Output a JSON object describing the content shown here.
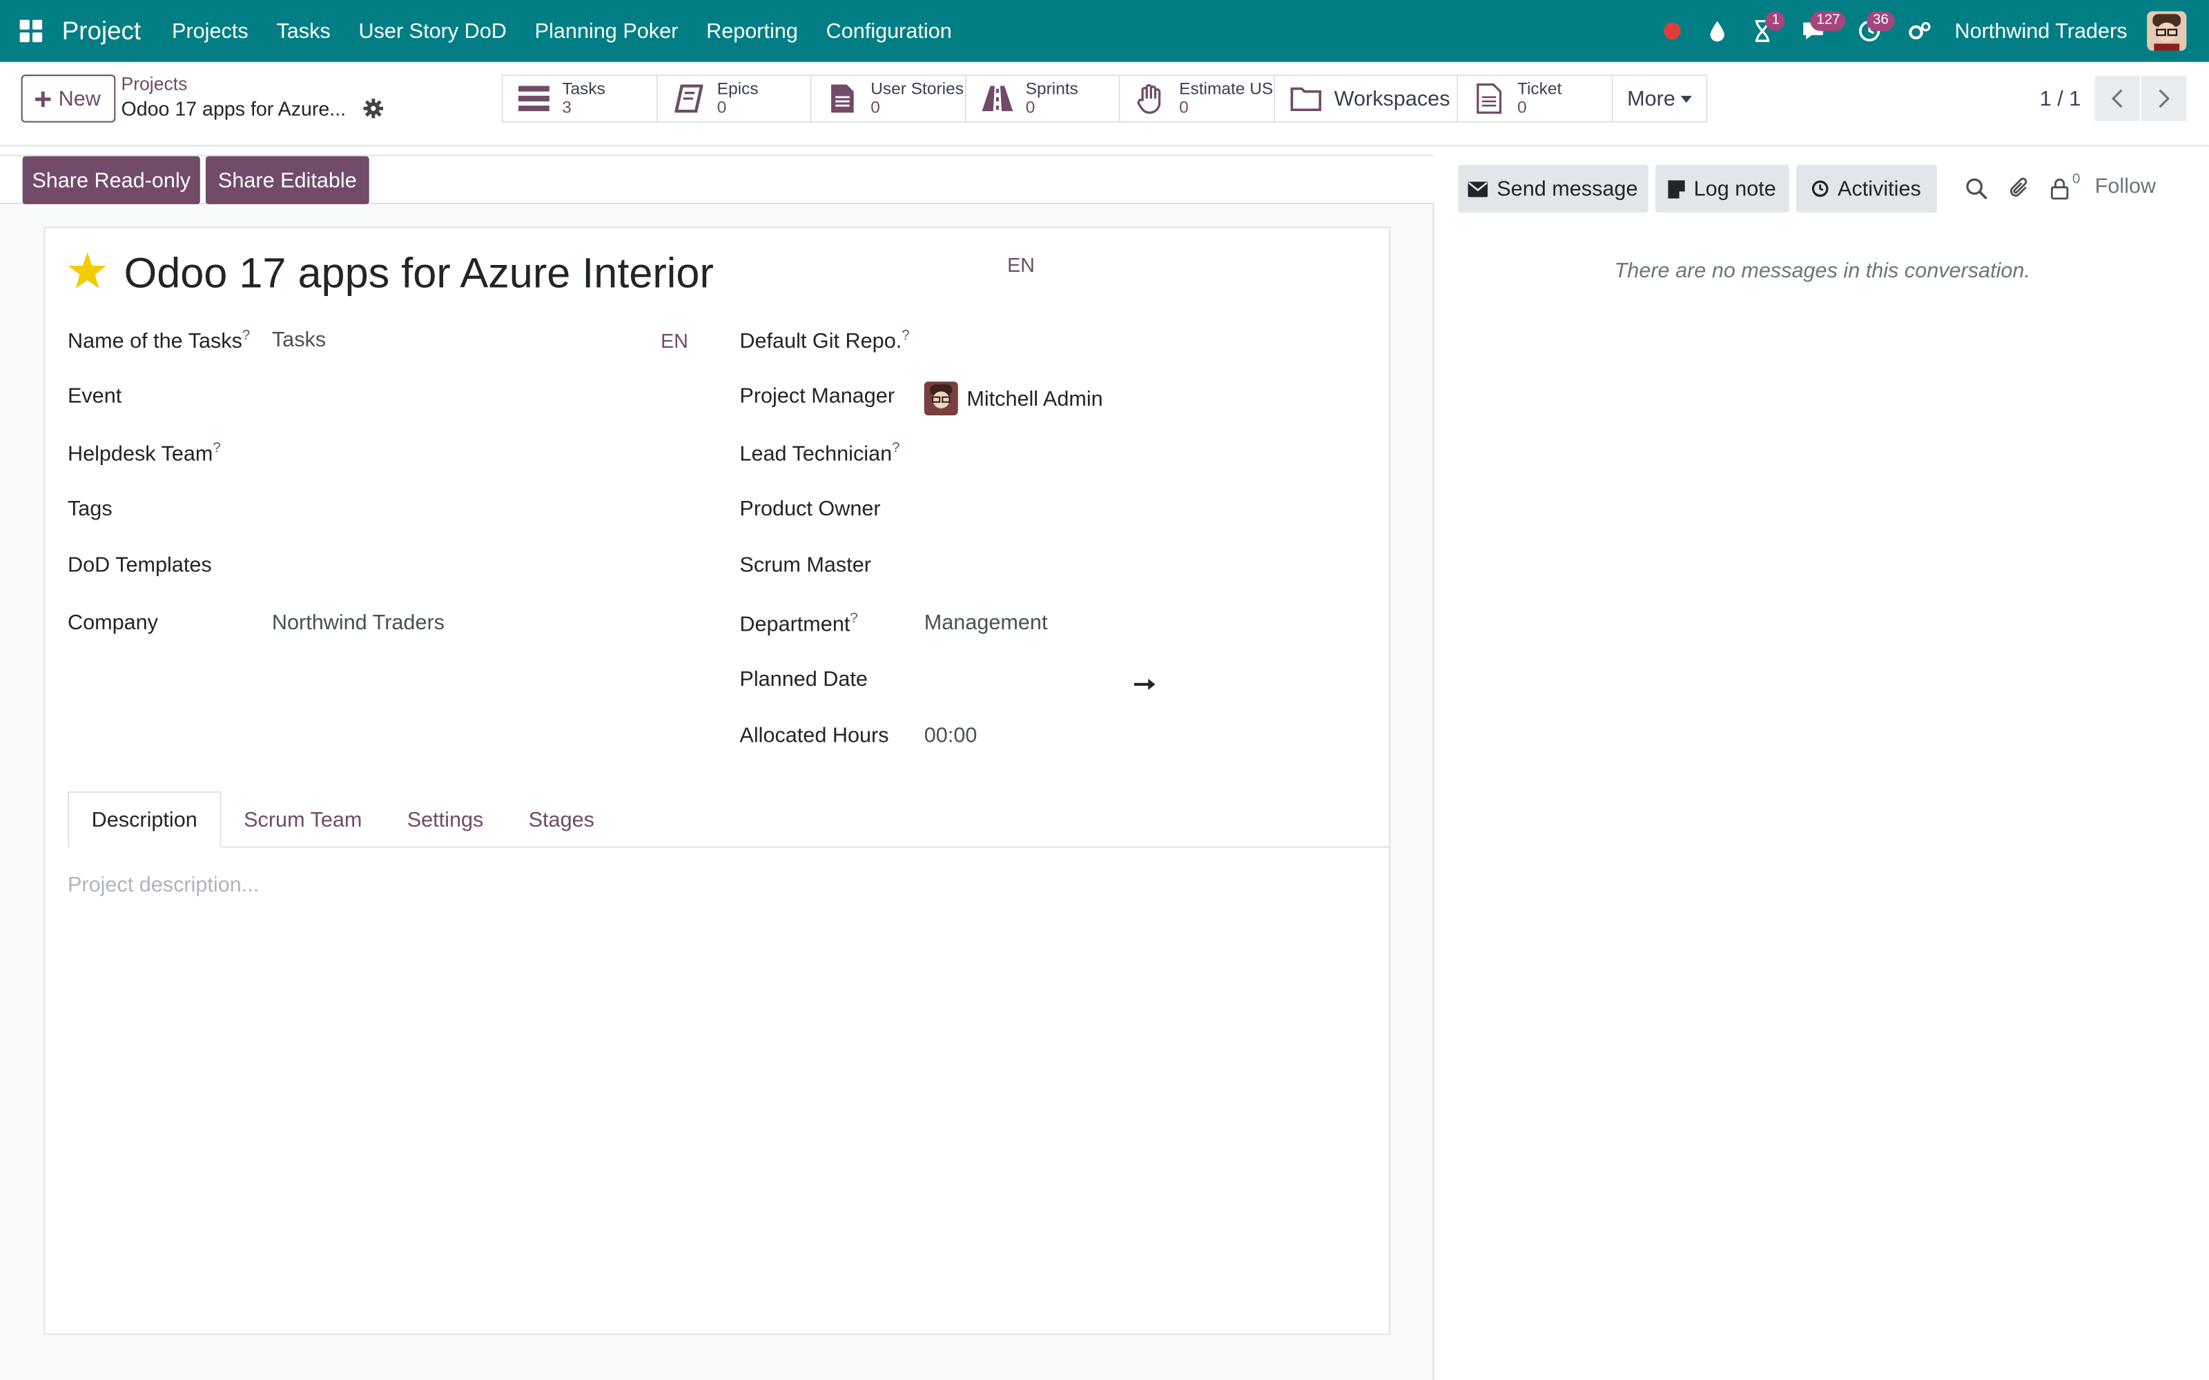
{
  "navbar": {
    "brand": "Project",
    "menus": [
      "Projects",
      "Tasks",
      "User Story DoD",
      "Planning Poker",
      "Reporting",
      "Configuration"
    ],
    "badges": {
      "activities": "1",
      "messages": "127",
      "clock": "36"
    },
    "company": "Northwind Traders",
    "colors": {
      "background": "#017e84",
      "badge": "#a2467c"
    }
  },
  "control": {
    "new_label": "New",
    "breadcrumb_parent": "Projects",
    "breadcrumb_current": "Odoo 17 apps for Azure...",
    "smart_buttons": [
      {
        "label": "Tasks",
        "count": "3",
        "icon": "tasks-icon"
      },
      {
        "label": "Epics",
        "count": "0",
        "icon": "book-icon"
      },
      {
        "label": "User Stories",
        "count": "0",
        "icon": "file-text-icon"
      },
      {
        "label": "Sprints",
        "count": "0",
        "icon": "road-icon"
      },
      {
        "label": "Estimate US",
        "count": "0",
        "icon": "hand-icon"
      },
      {
        "label": "Workspaces",
        "icon": "folder-icon"
      },
      {
        "label": "Ticket",
        "count": "0",
        "icon": "file-icon"
      }
    ],
    "more_label": "More",
    "pager": "1 / 1"
  },
  "statusbar": {
    "share_readonly": "Share Read-only",
    "share_editable": "Share Editable"
  },
  "form": {
    "title": "Odoo 17 apps for Azure Interior",
    "title_lang": "EN",
    "left": {
      "name_of_tasks_label": "Name of the Tasks",
      "name_of_tasks_value": "Tasks",
      "name_of_tasks_lang": "EN",
      "event_label": "Event",
      "helpdesk_team_label": "Helpdesk Team",
      "tags_label": "Tags",
      "dod_templates_label": "DoD Templates",
      "company_label": "Company",
      "company_value": "Northwind Traders"
    },
    "right": {
      "default_git_repo_label": "Default Git Repo.",
      "project_manager_label": "Project Manager",
      "project_manager_value": "Mitchell Admin",
      "lead_technician_label": "Lead Technician",
      "product_owner_label": "Product Owner",
      "scrum_master_label": "Scrum Master",
      "department_label": "Department",
      "department_value": "Management",
      "planned_date_label": "Planned Date",
      "allocated_hours_label": "Allocated Hours",
      "allocated_hours_value": "00:00"
    },
    "help_marker": "?",
    "tabs": [
      "Description",
      "Scrum Team",
      "Settings",
      "Stages"
    ],
    "description_placeholder": "Project description..."
  },
  "chatter": {
    "send_message": "Send message",
    "log_note": "Log note",
    "activities": "Activities",
    "follower_count": "0",
    "follow": "Follow",
    "empty": "There are no messages in this conversation."
  },
  "colors": {
    "accent": "#714b67",
    "star": "#f3cc00"
  }
}
